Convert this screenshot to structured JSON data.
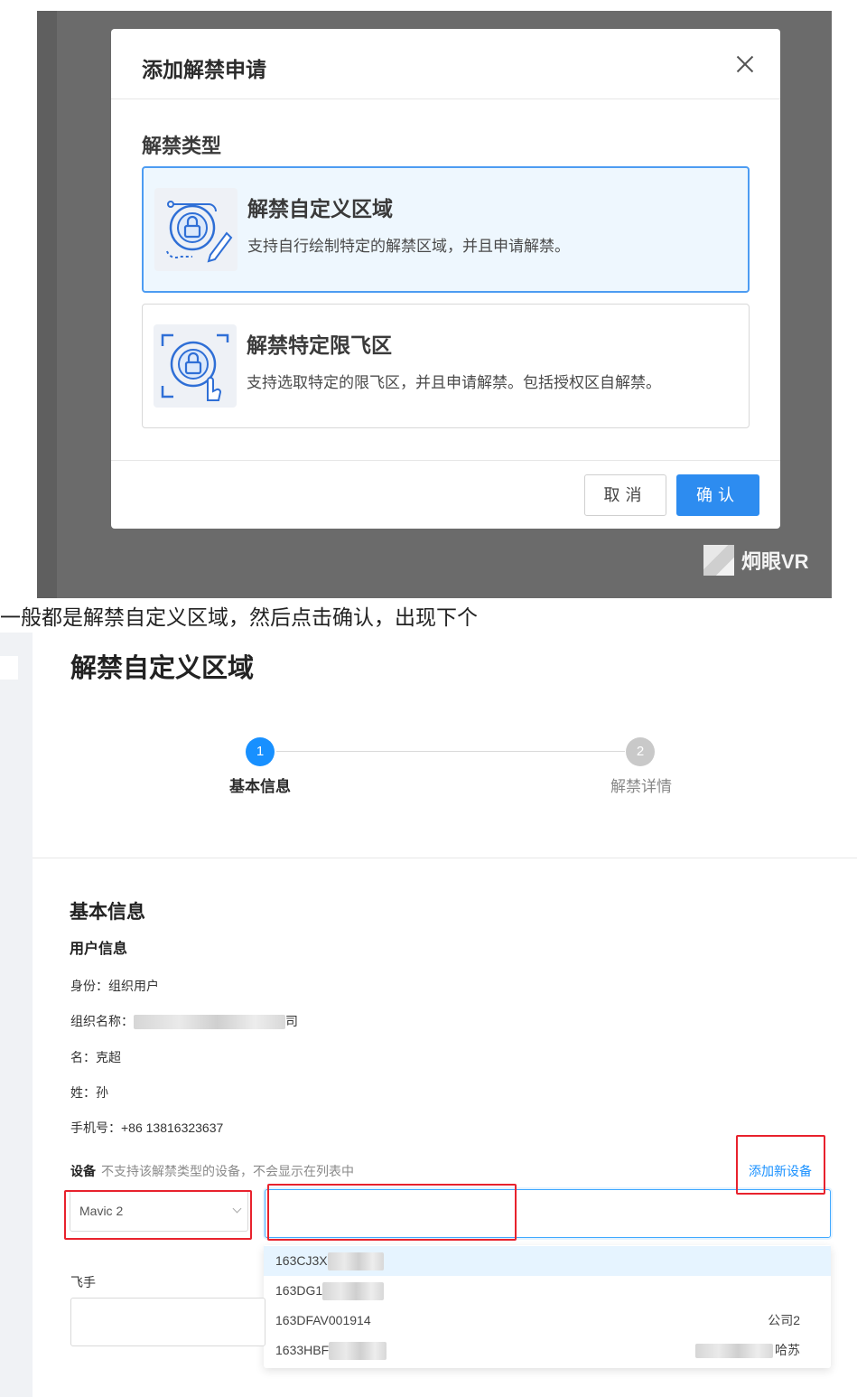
{
  "modal": {
    "title": "添加解禁申请",
    "type_label": "解禁类型",
    "options": [
      {
        "title": "解禁自定义区域",
        "desc": "支持自行绘制特定的解禁区域，并且申请解禁。",
        "selected": true,
        "icon": "lock-draw-icon"
      },
      {
        "title": "解禁特定限飞区",
        "desc": "支持选取特定的限飞区，并且申请解禁。包括授权区自解禁。",
        "selected": false,
        "icon": "lock-select-icon"
      }
    ],
    "cancel_label": "取消",
    "ok_label": "确认"
  },
  "watermark": "炯眼VR",
  "caption": "一般都是解禁自定义区域，然后点击确认，出现下个",
  "form": {
    "page_title": "解禁自定义区域",
    "steps": [
      {
        "num": "1",
        "label": "基本信息"
      },
      {
        "num": "2",
        "label": "解禁详情"
      }
    ],
    "section_title": "基本信息",
    "user_info_title": "用户信息",
    "identity_key": "身份：",
    "identity_value": "组织用户",
    "org_key": "组织名称：",
    "org_value_visible": "司",
    "first_name_key": "名：",
    "first_name_value": "克超",
    "last_name_key": "姓：",
    "last_name_value": "孙",
    "phone_key": "手机号：",
    "phone_value": "+86 13816323637",
    "device_label": "设备",
    "device_hint": "不支持该解禁类型的设备，不会显示在列表中",
    "add_device": "添加新设备",
    "device_model": "Mavic 2",
    "serials": [
      {
        "sn": "163CJ3X",
        "owner": ""
      },
      {
        "sn": "163DG1",
        "owner": ""
      },
      {
        "sn": "163DFAV001914",
        "owner": "公司2"
      },
      {
        "sn": "1633HBF",
        "owner": "哈苏"
      }
    ],
    "pilot_label": "飞手"
  },
  "colors": {
    "primary": "#2d8cf0",
    "highlight": "#e8222d",
    "selected_bg": "#eef7fe"
  }
}
